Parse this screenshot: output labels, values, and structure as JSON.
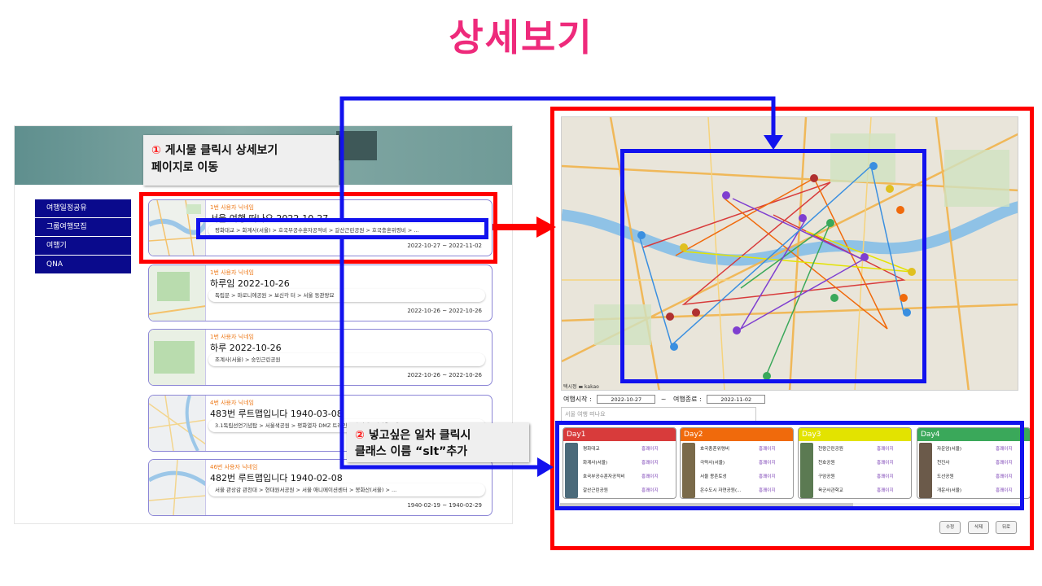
{
  "slide": {
    "title": "상세보기"
  },
  "callouts": {
    "one_number": "①",
    "one_line1": "게시물 클릭시 상세보기",
    "one_line2": "페이지로 이동",
    "two_number": "②",
    "two_line1": "넣고싶은 일차 클릭시",
    "two_line2": "클래스 이름 “slt”추가"
  },
  "sidebar": {
    "items": [
      {
        "label": "여행일정공유"
      },
      {
        "label": "그룹여행모집"
      },
      {
        "label": "여행기"
      },
      {
        "label": "QNA"
      }
    ]
  },
  "posts": [
    {
      "nick": "1번 사용자 닉네임",
      "title": "서울 여행 떠나요 2022-10-27",
      "route": "평화대교  >    화계사(서울)   >    호국부공수훈자공적비   >    갈산근린공원   >    호국충혼위령비  >  ...",
      "dates": "2022-10-27 ~ 2022-11-02"
    },
    {
      "nick": "1번 사용자 닉네임",
      "title": "하루임 2022-10-26",
      "route": "독립문  >    마로니에공원   >    보신각 터   >    서울 동관왕묘",
      "dates": "2022-10-26 ~ 2022-10-26"
    },
    {
      "nick": "1번 사용자 닉네임",
      "title": "하루 2022-10-26",
      "route": "조계사(서울)   >    숭인근린공원",
      "dates": "2022-10-26 ~ 2022-10-26"
    },
    {
      "nick": "4번 사용자 닉네임",
      "title": "483번 루트맵입니다 1940-03-08",
      "route": "3.1독립선언기념탑  >    서울색공원   >    평화열차 DMZ 트레인   >    호랑대공원이용우에  >  ...",
      "dates": ""
    },
    {
      "nick": "46번 사용자 닉네임",
      "title": "482번 루트맵입니다 1940-02-08",
      "route": "서울 관상감 관천대  >    현대원서공원   >    서울 애니메이션센터   >    봉화산(서울)  >  ...",
      "dates": "1940-02-19 ~ 1940-02-29"
    }
  ],
  "detail": {
    "start_label": "여행시작 :",
    "start_value": "2022-10-27",
    "tilde": "~",
    "end_label": "여행종료 :",
    "end_value": "2022-11-02",
    "plan_title": "서울 여행 떠나요",
    "map_credit": "텍시정 ▬ kakao",
    "days": [
      {
        "label": "Day1",
        "color": "#d83b3b",
        "places": [
          "평화대교",
          "화계사(서울)",
          "호국부공수훈자공적비",
          "갈산근린공원"
        ]
      },
      {
        "label": "Day2",
        "color": "#f06a0c",
        "places": [
          "호국충혼위령비",
          "극락사(서울)",
          "서울 몽촌토성",
          "온수도시 자연공원(..."
        ]
      },
      {
        "label": "Day3",
        "color": "#e3e300",
        "places": [
          "천왕근린공원",
          "천호공원",
          "구암공원",
          "육군사관학교"
        ]
      },
      {
        "label": "Day4",
        "color": "#3aa85a",
        "places": [
          "자운암(서울)",
          "천진사",
          "도선공원",
          "개운사(서울)"
        ]
      }
    ],
    "delete_label": "흥쾌이지",
    "buttons": {
      "edit": "수정",
      "delete": "삭제",
      "back": "뒤로"
    }
  },
  "colors": {
    "red_frame": "#ff0000",
    "blue_frame": "#1212ee",
    "title": "#ee2a7b",
    "sidebar": "#0a0a8c"
  }
}
